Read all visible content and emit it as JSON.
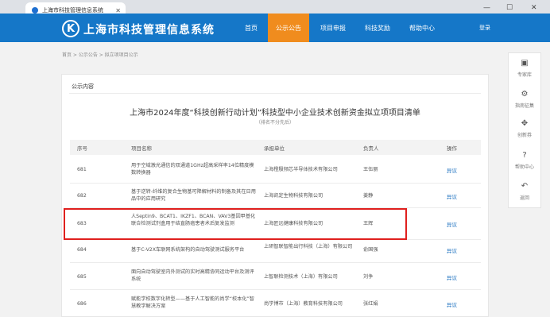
{
  "browser": {
    "tab_title": "上海市科技管理信息系统",
    "window_min": "—",
    "window_max": "☐",
    "window_close": "✕"
  },
  "header": {
    "logo_letter": "K",
    "site_title": "上海市科技管理信息系统",
    "nav": [
      "首页",
      "公示公告",
      "项目申报",
      "科技奖励",
      "帮助中心"
    ],
    "active_nav": "公示公告",
    "login": "登录",
    "brand_color": "#1577c8",
    "active_color": "#f08c1e"
  },
  "breadcrumb": "首页 > 公示公告 > 拟立项项目公示",
  "panel_label": "公示内容",
  "doc": {
    "title": "上海市2024年度“科技创新行动计划”科技型中小企业技术创新资金拟立项项目清单",
    "subtitle": "（排名不分先后）"
  },
  "table": {
    "headers": [
      "序号",
      "项目名称",
      "承担单位",
      "负责人",
      "操作"
    ],
    "rows": [
      {
        "no": "681",
        "name": "用于空域激光通信的双通道1GHz超高采样率14位精度模数转换器",
        "org": "上海橙殷频芯半导体技术有限公司",
        "lead": "王伍丽",
        "action": "异议"
      },
      {
        "no": "682",
        "name": "基于逆转-纤维的复合生物基可降解材料的制备及其在日用品中的应用研究",
        "org": "上海凯定生物科技有限公司",
        "lead": "姜静",
        "action": "异议"
      },
      {
        "no": "683",
        "name": "人Septin9、BCAT1、IKZF1、BCAN、VAV3基因甲基化联合检测试剂盒用于结直肠癌患者术后复发监测",
        "org": "上海匠远健康科技有限公司",
        "lead": "王辉",
        "action": "异议"
      },
      {
        "no": "684",
        "name": "基于C-V2X车联网系统架构的自动驾驶测试服务平台",
        "org": "上研智联智能出行科技（上海）有限公司",
        "lead": "俞国强",
        "action": "异议"
      },
      {
        "no": "685",
        "name": "面向自动驾驶室内外测试的实时高精协同运动平台及测评系统",
        "org": "上智联检测技术（上海）有限公司",
        "lead": "刘争",
        "action": "异议"
      },
      {
        "no": "686",
        "name": "赋能学校数字化转型——基于人工智能的尚学“校本化”智慧教学解决方案",
        "org": "尚学博市（上海）教育科技有限公司",
        "lead": "张红娟",
        "action": "异议"
      }
    ]
  },
  "side_panel": [
    {
      "icon": "card-icon",
      "glyph": "▣",
      "label": "专家库"
    },
    {
      "icon": "settings-icon",
      "glyph": "⚙",
      "label": "指南征集"
    },
    {
      "icon": "move-icon",
      "glyph": "✥",
      "label": "创新券"
    },
    {
      "icon": "help-icon",
      "glyph": "?",
      "label": "帮助中心"
    },
    {
      "icon": "return-icon",
      "glyph": "↶",
      "label": "返回"
    }
  ]
}
